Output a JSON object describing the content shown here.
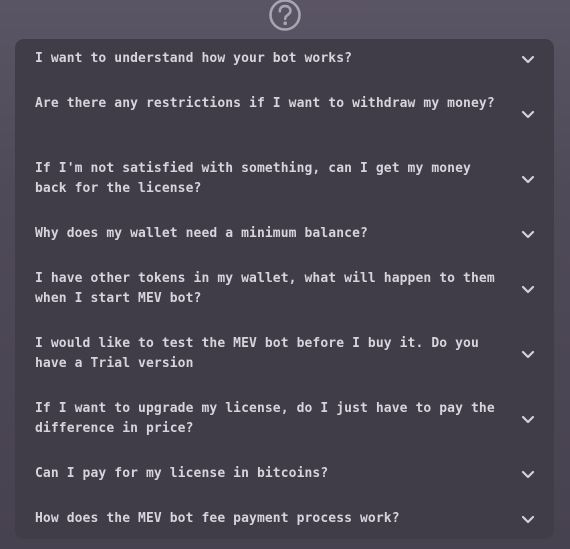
{
  "header": {
    "icon": "question-circle-icon"
  },
  "faq": {
    "items": [
      {
        "question": "I want to understand how your bot works?",
        "icon": "chevron-down-icon"
      },
      {
        "question": "Are there any restrictions if I want to withdraw my money?",
        "icon": "chevron-down-icon"
      },
      {
        "question": "If I'm not satisfied with something, can I get my money back for the license?",
        "icon": "chevron-down-icon"
      },
      {
        "question": "Why does my wallet need a minimum balance?",
        "icon": "chevron-down-icon"
      },
      {
        "question": "I have other tokens in my wallet, what will happen to them when I start MEV bot?",
        "icon": "chevron-down-icon"
      },
      {
        "question": "I would like to test the MEV bot before I buy it. Do you have a Trial version",
        "icon": "chevron-down-icon"
      },
      {
        "question": "If I want to upgrade my license, do I just have to pay the difference in price?",
        "icon": "chevron-down-icon"
      },
      {
        "question": "Can I pay for my license in bitcoins?",
        "icon": "chevron-down-icon"
      },
      {
        "question": "How does the MEV bot fee payment process work?",
        "icon": "chevron-down-icon"
      }
    ]
  },
  "colors": {
    "background": "#4f4a58",
    "panel": "#403c48",
    "text": "#d8d4dd",
    "icon": "#d4d0da"
  }
}
